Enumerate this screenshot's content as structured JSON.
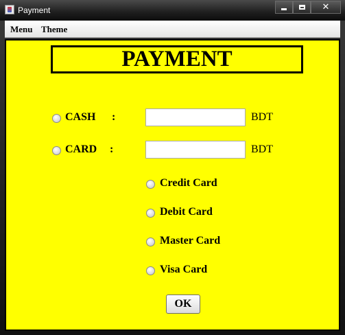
{
  "window": {
    "title": "Payment"
  },
  "menubar": {
    "items": [
      "Menu",
      "Theme"
    ]
  },
  "form": {
    "heading": "PAYMENT",
    "cash": {
      "label": "CASH",
      "colon": ":",
      "value": "",
      "unit": "BDT"
    },
    "card": {
      "label": "CARD",
      "colon": ":",
      "value": "",
      "unit": "BDT"
    },
    "card_types": [
      "Credit Card",
      "Debit Card",
      "Master Card",
      "Visa Card"
    ],
    "ok_label": "OK"
  },
  "colors": {
    "background": "#ffff00",
    "text": "#000000"
  }
}
